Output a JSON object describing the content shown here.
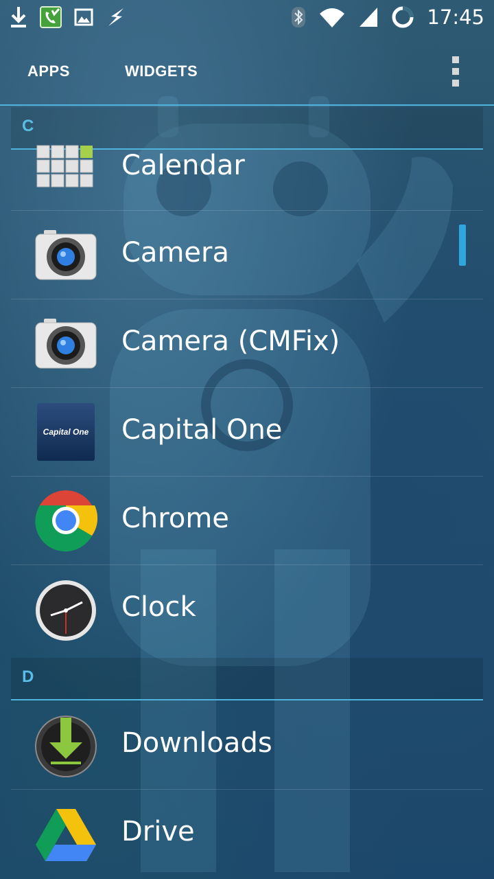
{
  "status_bar": {
    "time": "17:45",
    "left_icons": [
      "download-icon",
      "phone-icon",
      "image-icon",
      "lightning-icon"
    ],
    "right_icons": [
      "bluetooth-icon",
      "wifi-icon",
      "signal-icon",
      "battery-ring-icon"
    ]
  },
  "tabs": {
    "apps_label": "APPS",
    "widgets_label": "WIDGETS"
  },
  "sections": [
    {
      "letter": "C"
    },
    {
      "letter": "D"
    }
  ],
  "apps": [
    {
      "label": "Calendar",
      "icon": "calendar-icon"
    },
    {
      "label": "Camera",
      "icon": "camera-icon"
    },
    {
      "label": "Camera (CMFix)",
      "icon": "camera-icon"
    },
    {
      "label": "Capital One",
      "icon": "capital-one-icon",
      "icon_text": "Capital One"
    },
    {
      "label": "Chrome",
      "icon": "chrome-icon"
    },
    {
      "label": "Clock",
      "icon": "clock-icon"
    },
    {
      "label": "Downloads",
      "icon": "downloads-icon"
    },
    {
      "label": "Drive",
      "icon": "drive-icon"
    }
  ],
  "colors": {
    "accent": "#4fb3de",
    "scroll_thumb": "#2ea6de"
  }
}
